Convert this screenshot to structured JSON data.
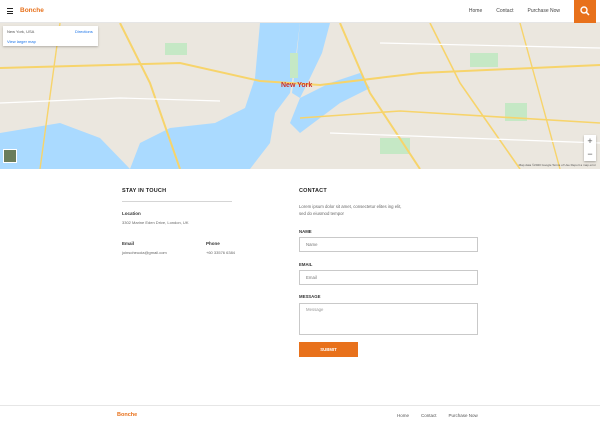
{
  "header": {
    "brand": "Bonche",
    "nav": [
      "Home",
      "Contact",
      "Purchase Now"
    ],
    "colors": {
      "accent": "#e8711b"
    }
  },
  "map": {
    "card_address": "New York, USA",
    "card_view_link": "View larger map",
    "card_directions": "Directions",
    "city_label": "New York",
    "zoom_in": "+",
    "zoom_out": "−",
    "attribution": "Map data ©2020 Google   Terms of Use   Report a map error"
  },
  "stay": {
    "title": "STAY IN TOUCH",
    "location_label": "Location",
    "location_value": "3302 Marine Eden Drive, London, UK",
    "email_label": "Email",
    "email_value": "joinsoheuoia@gmail.com",
    "phone_label": "Phone",
    "phone_value": "+60 33576 6384"
  },
  "contact": {
    "title": "CONTACT",
    "text": "Lorem ipsum dolor sit amet, consectetur elites ing elit, sed do eiusmod tempor",
    "name_label": "NAME",
    "name_placeholder": "Name",
    "email_label": "EMAIL",
    "email_placeholder": "Email",
    "message_label": "MESSAGE",
    "message_placeholder": "Message",
    "submit_label": "SUBMIT"
  },
  "footer": {
    "brand": "Bonche",
    "nav": [
      "Home",
      "Contact",
      "Purchase Now"
    ]
  }
}
